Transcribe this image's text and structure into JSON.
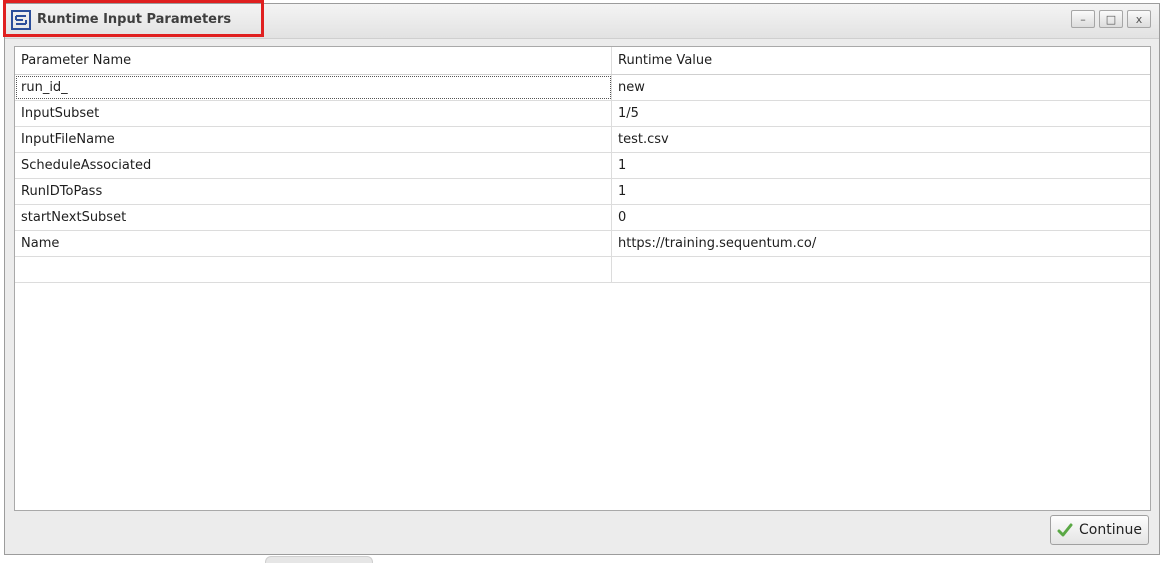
{
  "window": {
    "title": "Runtime Input Parameters",
    "controls": {
      "minimize_glyph": "–",
      "maximize_glyph": "□",
      "close_glyph": "x"
    },
    "highlight_color": "#e02020"
  },
  "grid": {
    "columns": [
      "Parameter Name",
      "Runtime Value"
    ],
    "rows": [
      {
        "name": "run_id_",
        "value": "new"
      },
      {
        "name": "InputSubset",
        "value": "1/5"
      },
      {
        "name": "InputFileName",
        "value": "test.csv"
      },
      {
        "name": "ScheduleAssociated",
        "value": "1"
      },
      {
        "name": "RunIDToPass",
        "value": "1"
      },
      {
        "name": "startNextSubset",
        "value": "0"
      },
      {
        "name": "Name",
        "value": "https://training.sequentum.co/"
      },
      {
        "name": "",
        "value": ""
      }
    ]
  },
  "footer": {
    "continue_label": "Continue",
    "continue_icon": "check-icon",
    "continue_icon_color": "#5aa845"
  }
}
